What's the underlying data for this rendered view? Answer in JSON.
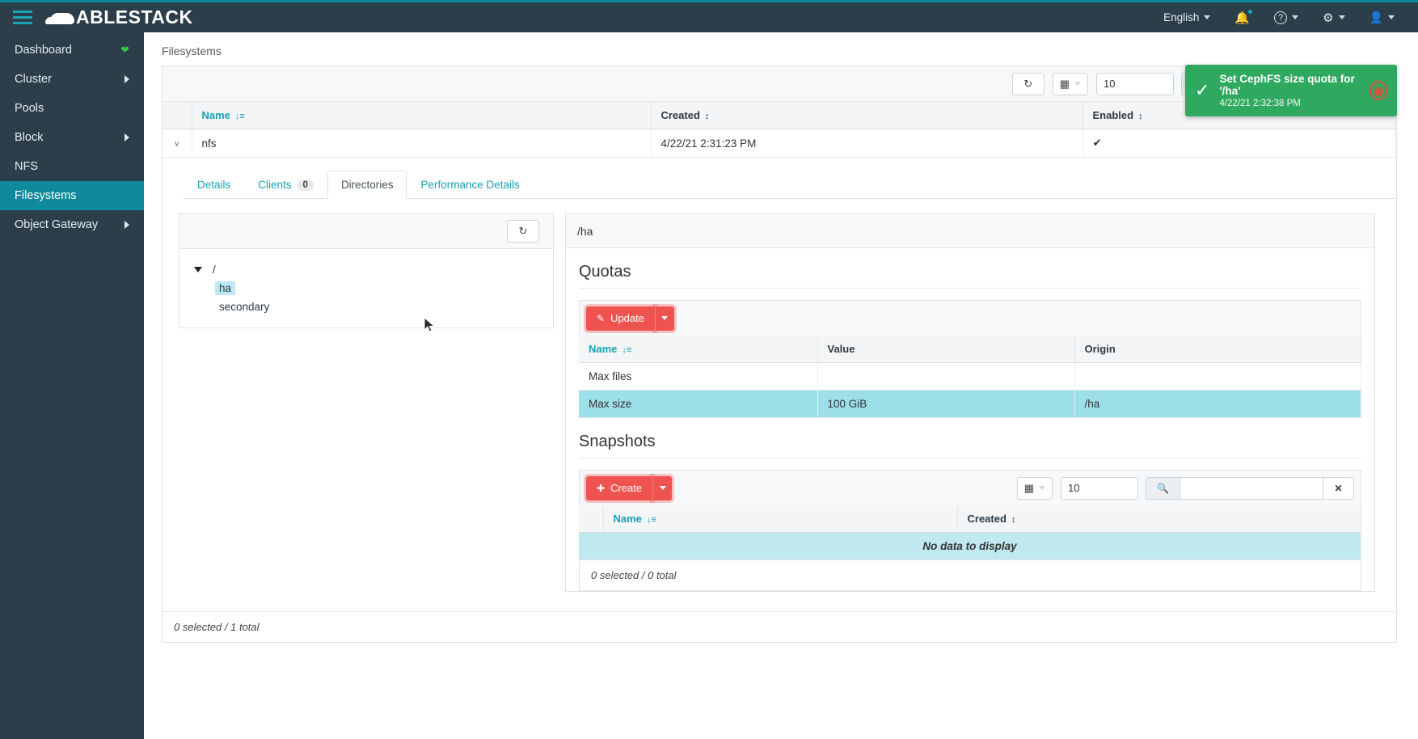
{
  "topbar": {
    "brand": "ABLESTACK",
    "menu_icon": "hamburger-icon",
    "language": "English",
    "notifications_icon": "bell-icon",
    "help_icon": "question-circle-icon",
    "settings_icon": "gear-icon",
    "user_icon": "user-icon"
  },
  "sidebar": {
    "items": [
      {
        "label": "Dashboard",
        "badge_icon": "heart-icon",
        "expandable": false,
        "active": false
      },
      {
        "label": "Cluster",
        "expandable": true,
        "active": false
      },
      {
        "label": "Pools",
        "expandable": false,
        "active": false
      },
      {
        "label": "Block",
        "expandable": true,
        "active": false
      },
      {
        "label": "NFS",
        "expandable": false,
        "active": false
      },
      {
        "label": "Filesystems",
        "expandable": false,
        "active": true
      },
      {
        "label": "Object Gateway",
        "expandable": true,
        "active": false
      }
    ]
  },
  "breadcrumb": "Filesystems",
  "toast": {
    "title": "Set CephFS size quota for '/ha'",
    "time": "4/22/21 2:32:38 PM",
    "check_icon": "check-icon",
    "logo_icon": "ceph-logo-icon",
    "color": "#2ea95f"
  },
  "fs_table": {
    "toolbar": {
      "refresh_icon": "refresh-icon",
      "columns_icon": "table-columns-icon",
      "page_size": "10",
      "search_icon": "search-icon",
      "search_value": "",
      "clear_icon": "clear-icon"
    },
    "columns": [
      "Name",
      "Created",
      "Enabled"
    ],
    "rows": [
      {
        "expand_icon": "chevron-down-icon",
        "name": "nfs",
        "created": "4/22/21 2:31:23 PM",
        "enabled": "✔"
      }
    ],
    "footer": "0 selected / 1 total"
  },
  "tabs": [
    {
      "label": "Details",
      "active": false
    },
    {
      "label": "Clients",
      "badge": "0",
      "active": false
    },
    {
      "label": "Directories",
      "active": true
    },
    {
      "label": "Performance Details",
      "active": false
    }
  ],
  "tree": {
    "refresh_icon": "refresh-icon",
    "root": {
      "label": "/",
      "expand_icon": "triangle-down-icon"
    },
    "children": [
      {
        "label": "ha",
        "selected": true
      },
      {
        "label": "secondary",
        "selected": false
      }
    ]
  },
  "detail": {
    "path": "/ha",
    "quotas": {
      "title": "Quotas",
      "update_label": "Update",
      "update_icon": "pencil-icon",
      "dropdown_icon": "caret-down-icon",
      "columns": [
        "Name",
        "Value",
        "Origin"
      ],
      "rows": [
        {
          "name": "Max files",
          "value": "",
          "origin": "",
          "highlighted": false
        },
        {
          "name": "Max size",
          "value": "100 GiB",
          "origin": "/ha",
          "highlighted": true
        }
      ]
    },
    "snapshots": {
      "title": "Snapshots",
      "create_label": "Create",
      "create_icon": "plus-icon",
      "dropdown_icon": "caret-down-icon",
      "columns_icon": "table-columns-icon",
      "page_size": "10",
      "search_icon": "search-icon",
      "search_value": "",
      "clear_icon": "clear-icon",
      "columns": [
        "Name",
        "Created"
      ],
      "empty_message": "No data to display",
      "footer": "0 selected / 0 total"
    }
  },
  "colors": {
    "brand_dark": "#2b3e4a",
    "accent_teal": "#0e8a9c",
    "link_teal": "#18a1b3",
    "danger": "#ef5350",
    "success": "#2ea95f",
    "row_highlight": "#9ddfe8"
  }
}
